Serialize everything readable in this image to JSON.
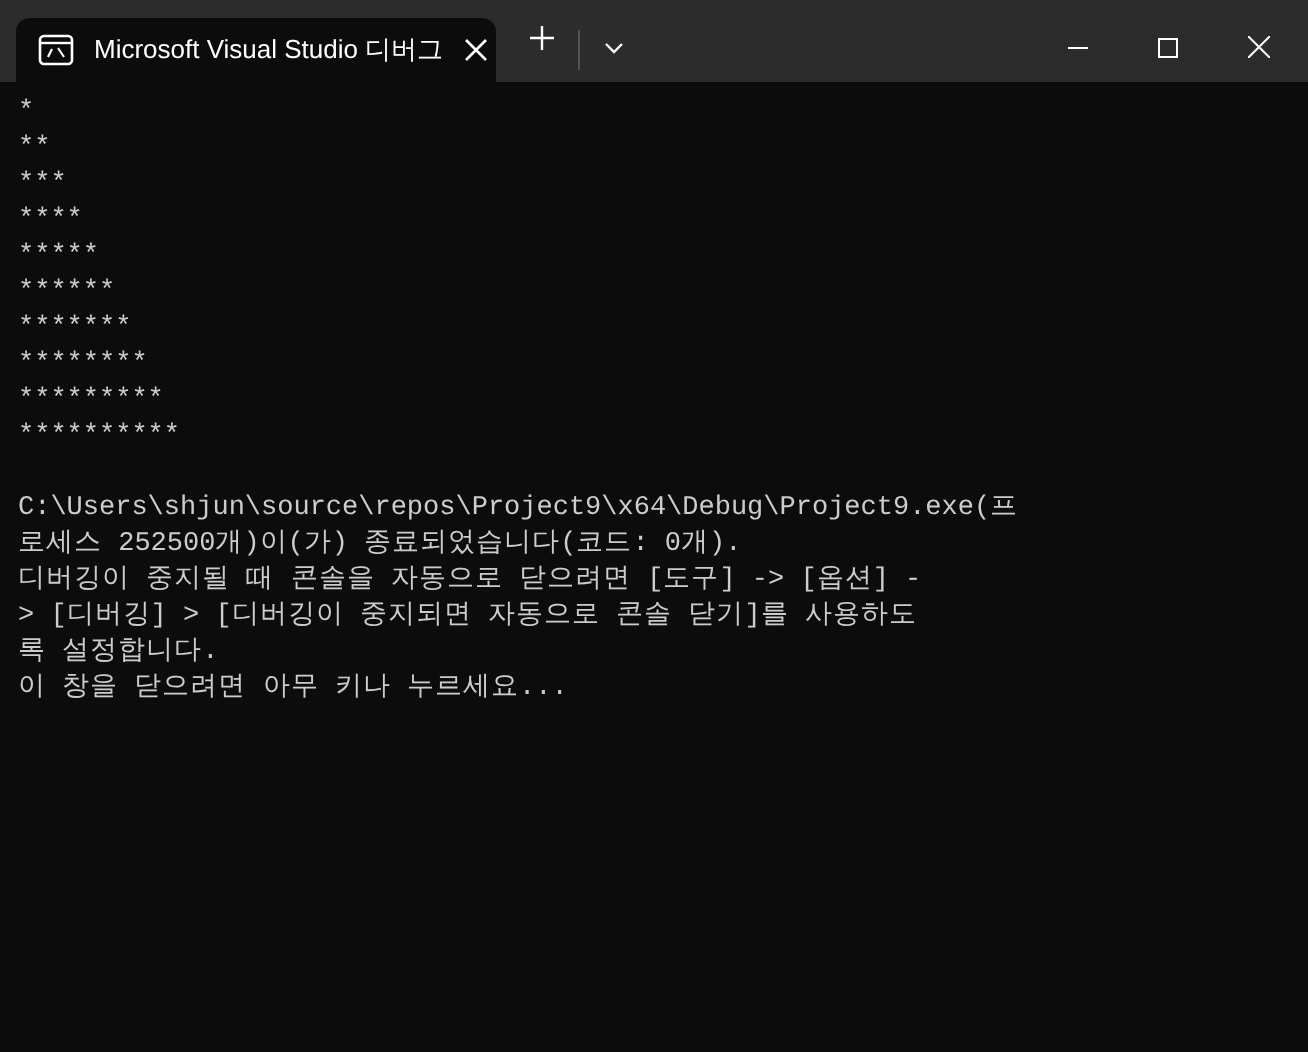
{
  "window": {
    "tab": {
      "title": "Microsoft Visual Studio 디버그",
      "selected": true
    }
  },
  "console": {
    "pattern_lines": [
      "*",
      "**",
      "***",
      "****",
      "*****",
      "******",
      "*******",
      "********",
      "*********",
      "**********"
    ],
    "message_lines": [
      "C:\\Users\\shjun\\source\\repos\\Project9\\x64\\Debug\\Project9.exe(프",
      "로세스 252500개)이(가) 종료되었습니다(코드: 0개).",
      "디버깅이 중지될 때 콘솔을 자동으로 닫으려면 [도구] -> [옵션] -",
      "> [디버깅] > [디버깅이 중지되면 자동으로 콘솔 닫기]를 사용하도",
      "록 설정합니다.",
      "이 창을 닫으려면 아무 키나 누르세요..."
    ]
  }
}
